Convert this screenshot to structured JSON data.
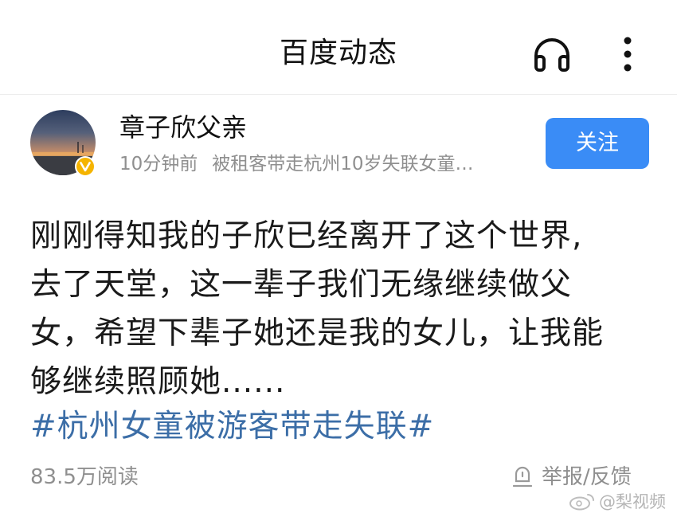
{
  "header": {
    "title": "百度动态",
    "icons": [
      "headphones-icon",
      "more-vertical-icon"
    ]
  },
  "author": {
    "name": "章子欣父亲",
    "verified_badge": "v-verified-badge",
    "time_ago": "10分钟前",
    "topic_preview": "被租客带走杭州10岁失联女童…",
    "follow_label": "关注"
  },
  "post": {
    "lines": [
      "刚刚得知我的子欣已经离开了这个世界,",
      "去了天堂，这一辈子我们无缘继续做父",
      "女，希望下辈子她还是我的女儿，让我能",
      "够继续照顾她......"
    ],
    "hashtag": "#杭州女童被游客带走失联#"
  },
  "footer": {
    "read_count": "83.5万阅读",
    "report_label": "举报/反馈"
  },
  "watermark": {
    "text": "@梨视频"
  },
  "colors": {
    "follow_button": "#3a8cf6",
    "hashtag": "#3c6ea7",
    "meta_text": "#8f8f8f",
    "badge": "#f5b400"
  }
}
